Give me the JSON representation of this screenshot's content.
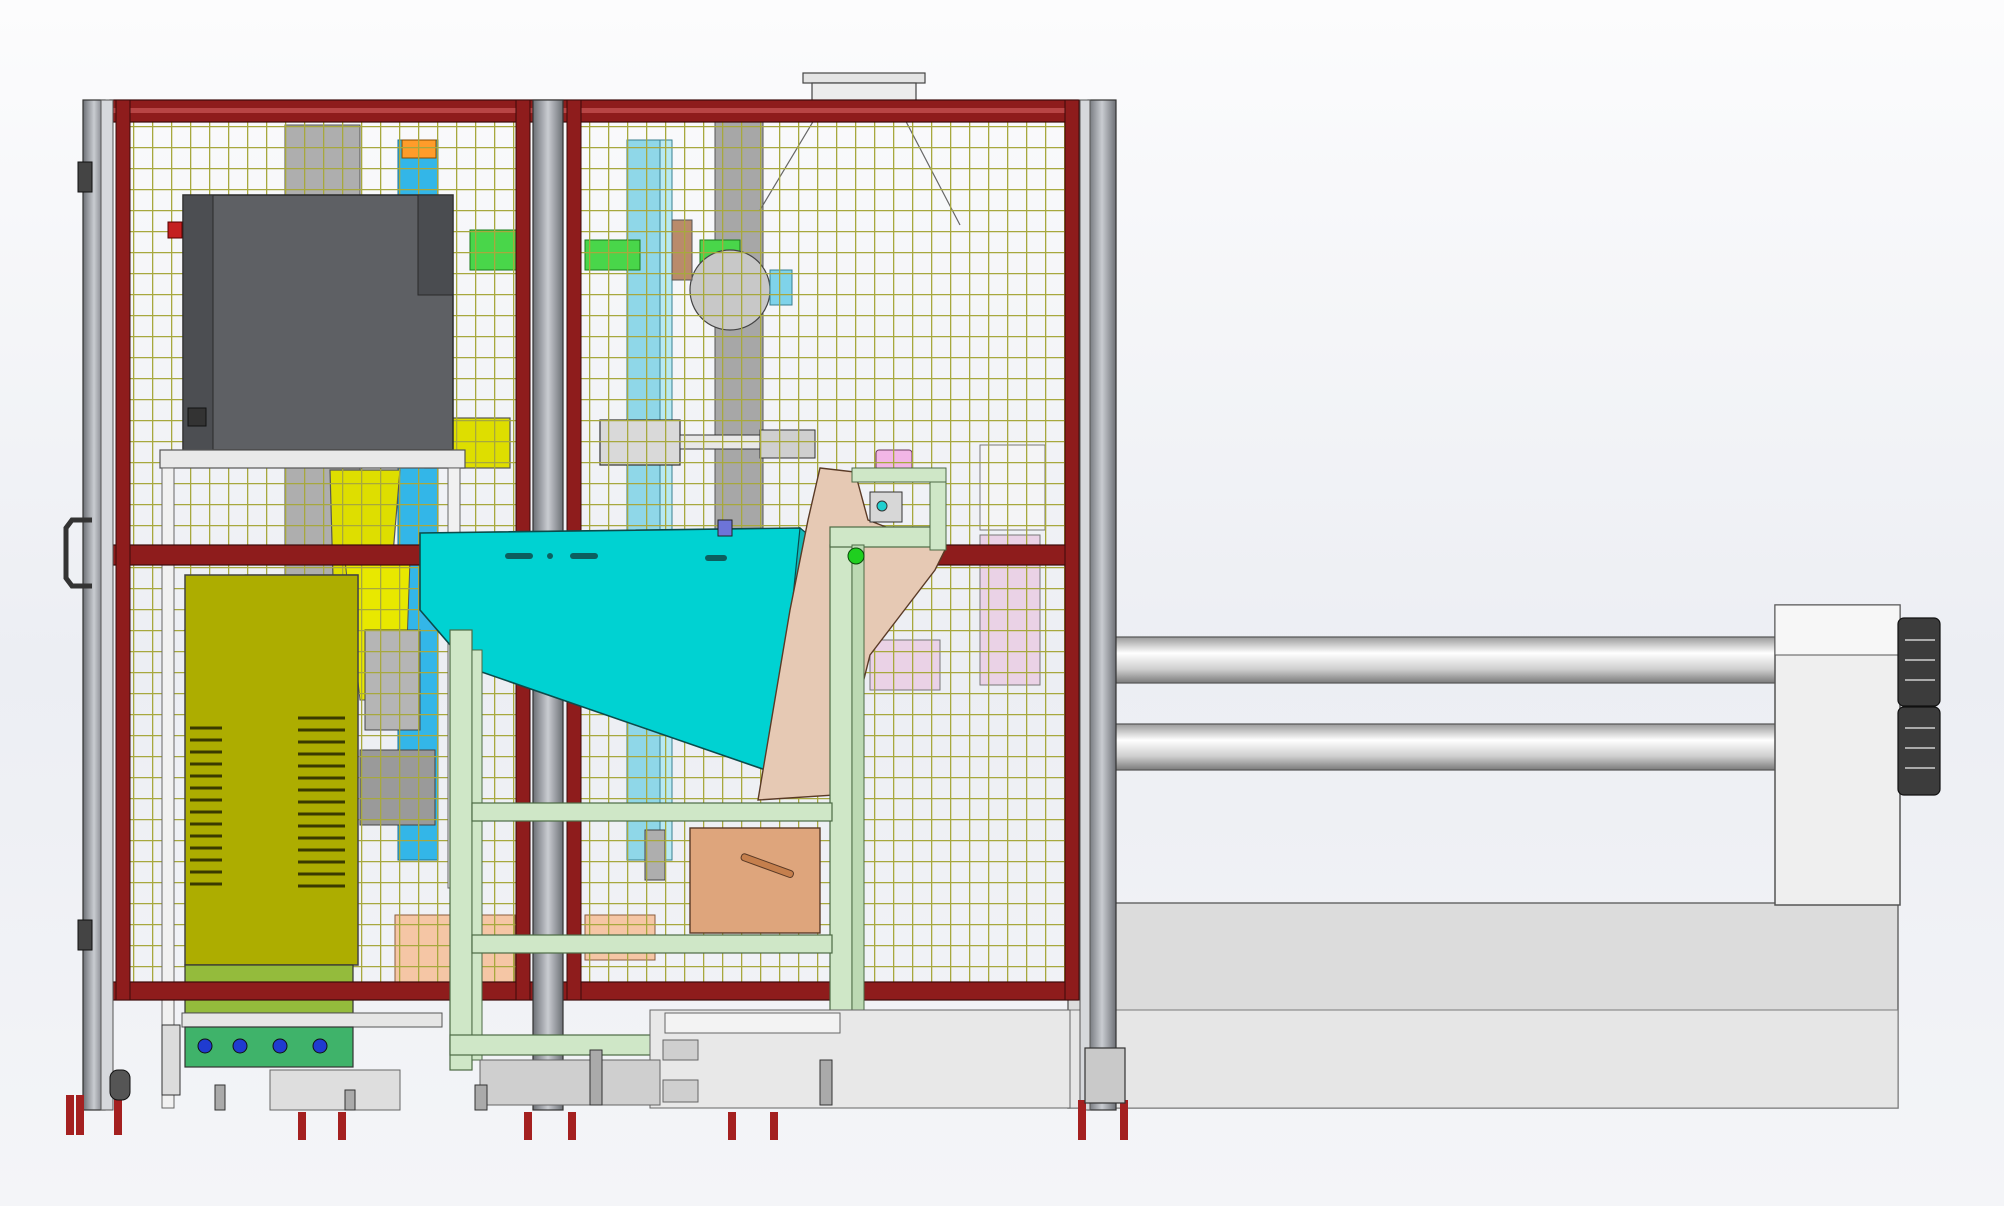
{
  "view": {
    "background_top": "#fcfcfd",
    "background_bottom": "#eceef3"
  },
  "colors": {
    "frame_post": "#9a9ea4",
    "frame_red": "#8e1c1c",
    "mesh": "#a7a83e",
    "hopper": "#00d2d2",
    "robot_yellow": "#dede00",
    "controller": "#adad00",
    "cabinet": "#5e6064",
    "wood": "#e6c9b4",
    "stand_green": "#cfe7c7",
    "bed_grey": "#dcdcdc",
    "rail": "#c9c9c9"
  }
}
